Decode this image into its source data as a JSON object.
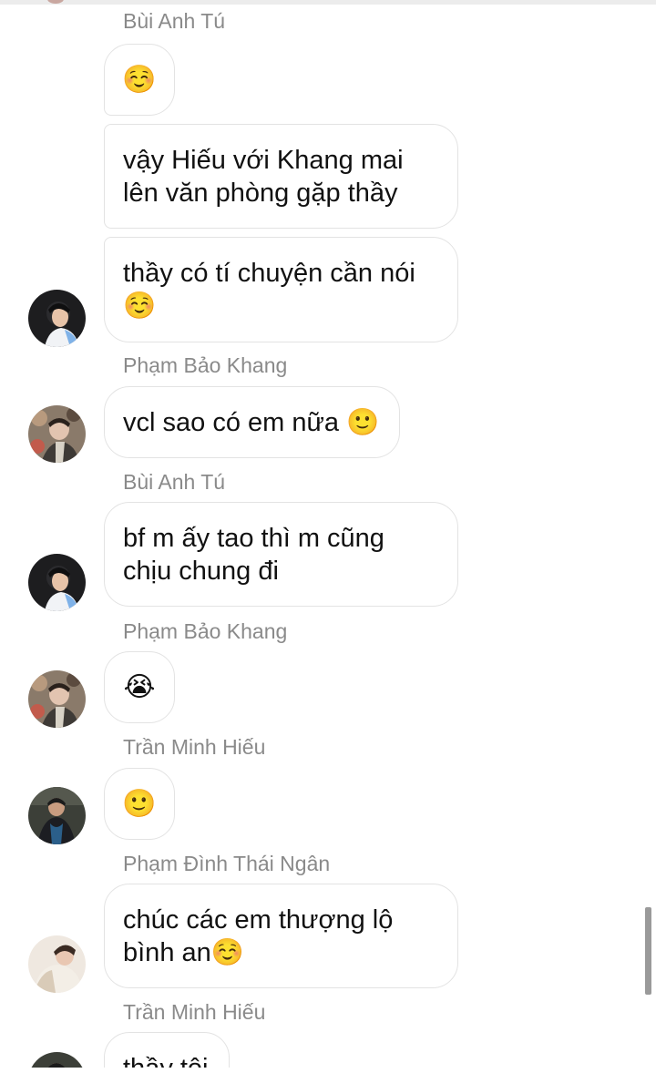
{
  "messages": [
    {
      "sender": "Bùi Anh Tú",
      "text": "☺️"
    },
    {
      "text": "vậy Hiếu với Khang mai\nlên văn phòng gặp thầy"
    },
    {
      "text": "thầy có tí chuyện cần nói\n☺️"
    },
    {
      "sender": "Phạm Bảo Khang",
      "text": "vcl sao có em nữa 🙂"
    },
    {
      "sender": "Bùi Anh Tú",
      "text": "bf m ấy tao thì m cũng\nchịu chung đi"
    },
    {
      "sender": "Phạm Bảo Khang",
      "text": "😭"
    },
    {
      "sender": "Trần Minh Hiếu",
      "text": "🙂"
    },
    {
      "sender": "Phạm Đình Thái Ngân",
      "text": "chúc các em thượng lộ\nbình an☺️"
    },
    {
      "sender": "Trần Minh Hiếu",
      "text": "thầy tôi"
    }
  ],
  "avatars": {
    "tu": "avatar-bui-anh-tu",
    "khang": "avatar-pham-bao-khang",
    "hieu": "avatar-tran-minh-hieu",
    "ngan": "avatar-pham-dinh-thai-ngan"
  }
}
